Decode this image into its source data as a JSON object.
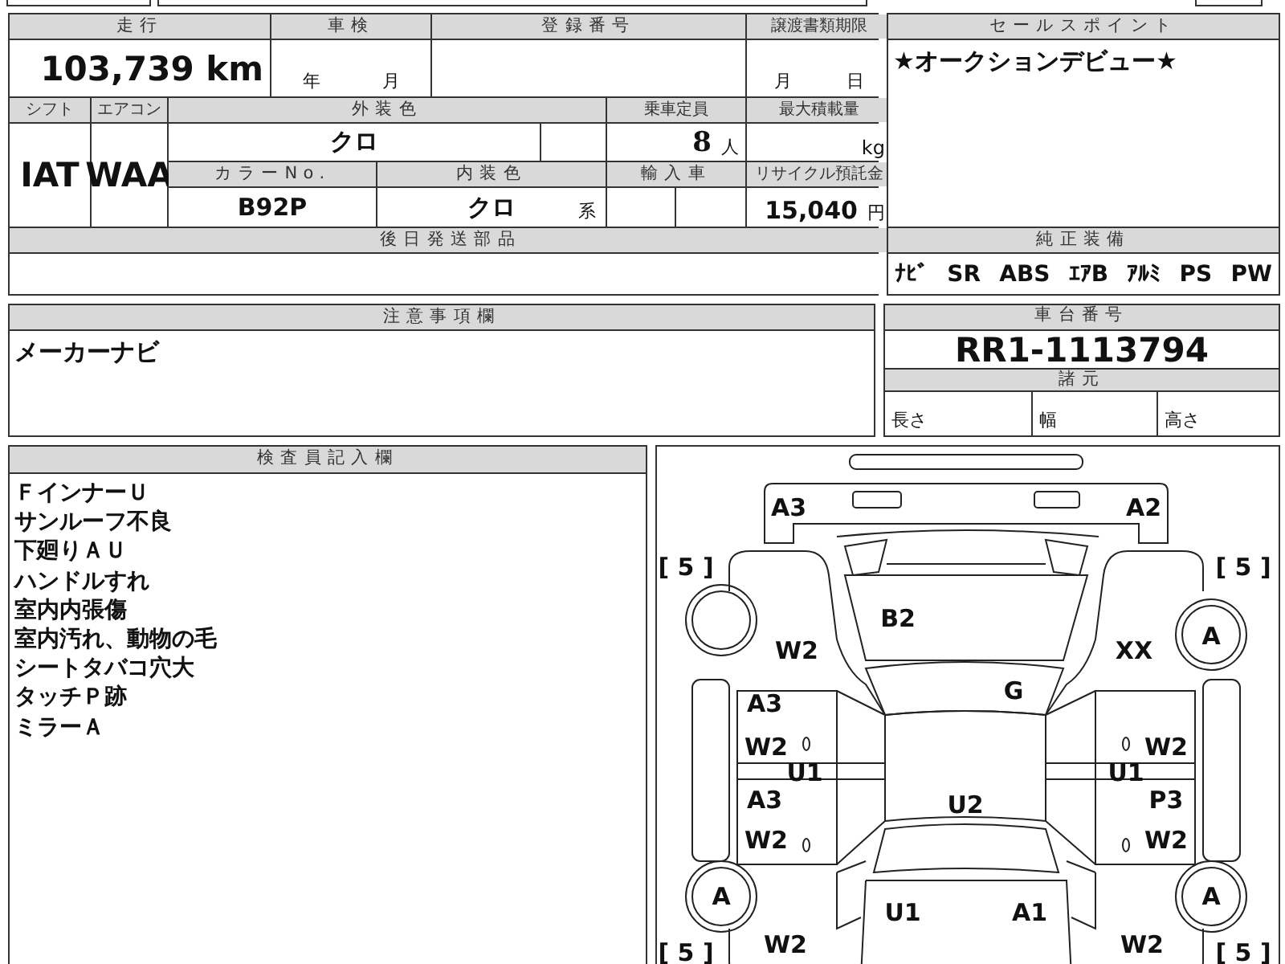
{
  "sheet": {
    "mileage": {
      "label": "走行",
      "value": "103,739 km"
    },
    "inspection": {
      "label": "車検",
      "year_unit": "年",
      "month_unit": "月"
    },
    "registration_number": {
      "label": "登録番号"
    },
    "transfer_deadline": {
      "label": "譲渡書類期限",
      "month_unit": "月",
      "day_unit": "日"
    },
    "shift": {
      "label": "シフト",
      "value": "IAT"
    },
    "air_conditioner": {
      "label": "エアコン",
      "value": "WAA"
    },
    "exterior_color": {
      "label": "外装色",
      "value": "クロ"
    },
    "capacity": {
      "label": "乗車定員",
      "value": "8",
      "unit": "人"
    },
    "max_load": {
      "label": "最大積載量",
      "unit": "kg"
    },
    "color_no": {
      "label": "カラーNo.",
      "value": "B92P"
    },
    "interior_color": {
      "label": "内装色",
      "value": "クロ",
      "suffix": "系"
    },
    "imported": {
      "label": "輸入車"
    },
    "recycle_deposit": {
      "label": "リサイクル預託金",
      "value": "15,040",
      "unit": "円"
    },
    "later_parts": {
      "label": "後日発送部品"
    }
  },
  "sales_point": {
    "label": "セールスポイント",
    "text": "★オークションデビュー★"
  },
  "equipment": {
    "label": "純正装備",
    "items": [
      "ﾅﾋﾞ",
      "SR",
      "ABS",
      "ｴｱB",
      "ｱﾙﾐ",
      "PS",
      "PW"
    ]
  },
  "notes": {
    "label": "注意事項欄",
    "text": "メーカーナビ"
  },
  "chassis": {
    "label": "車台番号",
    "value": "RR1-1113794"
  },
  "specs": {
    "label": "諸元",
    "fields": [
      "長さ",
      "幅",
      "高さ"
    ]
  },
  "inspector": {
    "label": "検査員記入欄",
    "lines": [
      "ＦインナーＵ",
      "サンルーフ不良",
      "下廻りＡＵ",
      "ハンドルすれ",
      "室内内張傷",
      "室内汚れ、動物の毛",
      "シートタバコ穴大",
      "タッチＰ跡",
      "ミラーＡ"
    ]
  },
  "diagram": {
    "marks": [
      "A3",
      "A2",
      "[ 5 ]",
      "[ 5 ]",
      "B2",
      "W2",
      "XX",
      "A",
      "G",
      "A3",
      "W2",
      "U1",
      "W2",
      "U1",
      "A3",
      "U2",
      "P3",
      "W2",
      "W2",
      "A",
      "A",
      "U1",
      "A1",
      "W2",
      "W2",
      "[ 5 ]",
      "[ 5 ]"
    ]
  }
}
